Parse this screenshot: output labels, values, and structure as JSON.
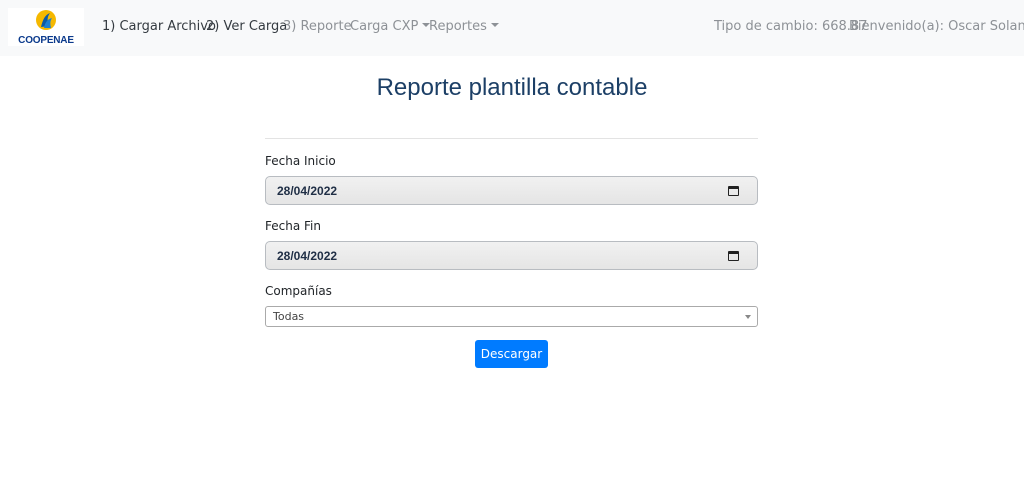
{
  "navbar": {
    "logo_text": "COOPENAE",
    "links": [
      {
        "label": "1) Cargar Archivo"
      },
      {
        "label": "2) Ver Carga"
      },
      {
        "label": "3) Reporte"
      },
      {
        "label": "Carga CXP"
      },
      {
        "label": "Reportes"
      }
    ],
    "exchange_rate": "Tipo de cambio: 668.87",
    "user": "Bienvenido(a): Oscar Solano"
  },
  "page": {
    "title": "Reporte plantilla contable"
  },
  "form": {
    "fecha_inicio_label": "Fecha Inicio",
    "fecha_inicio_value": "28/04/2022",
    "fecha_fin_label": "Fecha Fin",
    "fecha_fin_value": "28/04/2022",
    "companias_label": "Compañías",
    "companias_value": "Todas",
    "download_label": "Descargar"
  },
  "colors": {
    "navbar_bg": "#f8f9fa",
    "title": "#1c3f66",
    "primary_button": "#007bff",
    "logo_text": "#0b3a8c"
  },
  "icons": [
    "coopenae-logo",
    "calendar-icon",
    "chevron-down-icon"
  ]
}
